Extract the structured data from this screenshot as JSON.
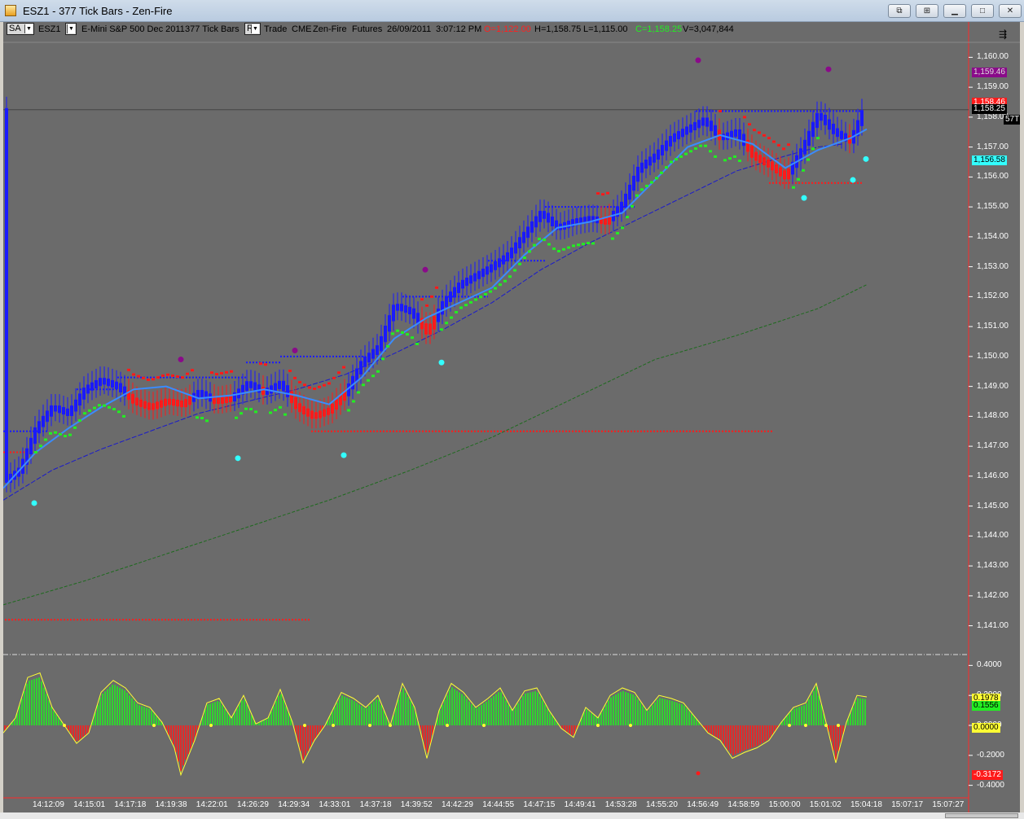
{
  "window": {
    "title": "ESZ1 - 377 Tick Bars - Zen-Fire"
  },
  "status": {
    "sa": "SA",
    "instrument": "ESZ1",
    "instr_label": "E-Mini S&P 500 Dec 2011",
    "bar_type": "377 Tick Bars",
    "r_btn": "R",
    "trade": "Trade",
    "exchange": "CME",
    "feed": "Zen-Fire",
    "kind": "Futures",
    "date": "26/09/2011",
    "time": "3:07:12 PM",
    "open": "O=1,122.00",
    "high": "H=1,158.75",
    "low": "L=1,115.00",
    "close": "C=1,158.25",
    "volume": "V=3,047,844"
  },
  "price_axis": [
    "1,160.00",
    "1,159.00",
    "1,158.00",
    "1,157.00",
    "1,156.00",
    "1,155.00",
    "1,154.00",
    "1,153.00",
    "1,152.00",
    "1,151.00",
    "1,150.00",
    "1,149.00",
    "1,148.00",
    "1,147.00",
    "1,146.00",
    "1,145.00",
    "1,144.00",
    "1,143.00",
    "1,142.00",
    "1,141.00"
  ],
  "price_tags": {
    "purple": "1,159.46",
    "red": "1,158.46",
    "last": "1,158.25",
    "tick": "57T",
    "cyan": "1,156.58"
  },
  "osc_axis": [
    "0.4000",
    "0.2000",
    "0.0000",
    "-0.2000",
    "-0.4000"
  ],
  "osc_tags": {
    "yellow": "0.1978",
    "green": "0.1556",
    "zero": "0.0000",
    "red": "-0.3172"
  },
  "time_axis": [
    "14:12:09",
    "14:15:01",
    "14:17:18",
    "14:19:38",
    "14:22:01",
    "14:26:29",
    "14:29:34",
    "14:33:01",
    "14:37:18",
    "14:39:52",
    "14:42:29",
    "14:44:55",
    "14:47:15",
    "14:49:41",
    "14:53:28",
    "14:55:20",
    "14:56:49",
    "14:58:59",
    "15:00:00",
    "15:01:02",
    "15:04:18",
    "15:07:17",
    "15:07:27"
  ],
  "colors": {
    "bg": "#6b6b6b",
    "up": "#1a1aff",
    "down": "#ff1a1a",
    "green": "#22ee22",
    "cyan": "#33ffff",
    "purple": "#8a0a8a",
    "yellow": "#ffff33"
  },
  "chart_data": {
    "type": "bar",
    "instrument": "ESZ1",
    "ylim": [
      1140.5,
      1160.5
    ],
    "close_path": [
      [
        0,
        1145.8
      ],
      [
        20,
        1146.2
      ],
      [
        40,
        1147.6
      ],
      [
        60,
        1148.3
      ],
      [
        80,
        1148.1
      ],
      [
        100,
        1148.9
      ],
      [
        120,
        1149.2
      ],
      [
        140,
        1149.0
      ],
      [
        160,
        1148.5
      ],
      [
        180,
        1148.3
      ],
      [
        200,
        1148.5
      ],
      [
        220,
        1148.4
      ],
      [
        240,
        1148.8
      ],
      [
        260,
        1148.5
      ],
      [
        280,
        1148.6
      ],
      [
        300,
        1149.1
      ],
      [
        320,
        1148.8
      ],
      [
        340,
        1149.1
      ],
      [
        360,
        1148.3
      ],
      [
        380,
        1148.0
      ],
      [
        400,
        1148.2
      ],
      [
        420,
        1148.8
      ],
      [
        440,
        1149.8
      ],
      [
        460,
        1150.3
      ],
      [
        480,
        1151.7
      ],
      [
        500,
        1151.5
      ],
      [
        520,
        1150.8
      ],
      [
        540,
        1151.8
      ],
      [
        560,
        1152.4
      ],
      [
        580,
        1152.7
      ],
      [
        600,
        1153.0
      ],
      [
        620,
        1153.4
      ],
      [
        640,
        1154.1
      ],
      [
        660,
        1154.8
      ],
      [
        680,
        1154.3
      ],
      [
        700,
        1154.5
      ],
      [
        720,
        1154.6
      ],
      [
        740,
        1154.5
      ],
      [
        760,
        1155.1
      ],
      [
        780,
        1156.3
      ],
      [
        800,
        1156.7
      ],
      [
        820,
        1157.3
      ],
      [
        840,
        1157.6
      ],
      [
        860,
        1157.9
      ],
      [
        880,
        1157.3
      ],
      [
        900,
        1157.5
      ],
      [
        920,
        1156.7
      ],
      [
        940,
        1156.4
      ],
      [
        960,
        1156.0
      ],
      [
        980,
        1156.9
      ],
      [
        1000,
        1158.1
      ],
      [
        1020,
        1157.5
      ],
      [
        1040,
        1157.2
      ],
      [
        1055,
        1158.2
      ]
    ],
    "ema_fast_path": [
      [
        0,
        1145.6
      ],
      [
        40,
        1146.8
      ],
      [
        80,
        1147.6
      ],
      [
        120,
        1148.3
      ],
      [
        160,
        1148.9
      ],
      [
        200,
        1149.0
      ],
      [
        240,
        1148.6
      ],
      [
        280,
        1148.7
      ],
      [
        320,
        1148.9
      ],
      [
        360,
        1148.7
      ],
      [
        400,
        1148.4
      ],
      [
        440,
        1149.3
      ],
      [
        480,
        1150.6
      ],
      [
        520,
        1151.3
      ],
      [
        560,
        1151.8
      ],
      [
        600,
        1152.3
      ],
      [
        640,
        1153.4
      ],
      [
        680,
        1154.3
      ],
      [
        720,
        1154.5
      ],
      [
        760,
        1154.8
      ],
      [
        800,
        1155.9
      ],
      [
        840,
        1157.0
      ],
      [
        880,
        1157.4
      ],
      [
        920,
        1157.1
      ],
      [
        960,
        1156.3
      ],
      [
        1000,
        1156.9
      ],
      [
        1040,
        1157.3
      ],
      [
        1060,
        1157.6
      ]
    ],
    "ema_slow_path": [
      [
        0,
        1145.2
      ],
      [
        60,
        1146.2
      ],
      [
        120,
        1146.9
      ],
      [
        180,
        1147.5
      ],
      [
        240,
        1148.1
      ],
      [
        300,
        1148.5
      ],
      [
        360,
        1148.9
      ],
      [
        420,
        1149.4
      ],
      [
        480,
        1150.1
      ],
      [
        540,
        1150.9
      ],
      [
        600,
        1151.8
      ],
      [
        660,
        1152.9
      ],
      [
        720,
        1153.8
      ],
      [
        780,
        1154.6
      ],
      [
        840,
        1155.4
      ],
      [
        900,
        1156.2
      ],
      [
        960,
        1156.7
      ],
      [
        1000,
        1157.0
      ],
      [
        1030,
        1157.1
      ]
    ],
    "ema_long_path": [
      [
        0,
        1141.7
      ],
      [
        100,
        1142.5
      ],
      [
        200,
        1143.4
      ],
      [
        300,
        1144.3
      ],
      [
        400,
        1145.2
      ],
      [
        500,
        1146.2
      ],
      [
        600,
        1147.3
      ],
      [
        700,
        1148.6
      ],
      [
        800,
        1149.9
      ],
      [
        900,
        1150.7
      ],
      [
        1000,
        1151.6
      ],
      [
        1060,
        1152.4
      ]
    ],
    "osc_path": [
      [
        0,
        -0.05
      ],
      [
        15,
        0.05
      ],
      [
        30,
        0.32
      ],
      [
        45,
        0.35
      ],
      [
        60,
        0.12
      ],
      [
        75,
        0.0
      ],
      [
        90,
        -0.12
      ],
      [
        105,
        -0.05
      ],
      [
        120,
        0.22
      ],
      [
        135,
        0.3
      ],
      [
        150,
        0.25
      ],
      [
        165,
        0.15
      ],
      [
        180,
        0.12
      ],
      [
        195,
        0.02
      ],
      [
        210,
        -0.15
      ],
      [
        218,
        -0.33
      ],
      [
        235,
        -0.1
      ],
      [
        250,
        0.15
      ],
      [
        265,
        0.18
      ],
      [
        280,
        0.05
      ],
      [
        295,
        0.2
      ],
      [
        310,
        0.01
      ],
      [
        325,
        0.05
      ],
      [
        340,
        0.24
      ],
      [
        355,
        0.02
      ],
      [
        368,
        -0.25
      ],
      [
        382,
        -0.1
      ],
      [
        395,
        0.0
      ],
      [
        415,
        0.22
      ],
      [
        430,
        0.18
      ],
      [
        445,
        0.12
      ],
      [
        460,
        0.2
      ],
      [
        475,
        0.0
      ],
      [
        490,
        0.28
      ],
      [
        505,
        0.12
      ],
      [
        520,
        -0.22
      ],
      [
        535,
        0.1
      ],
      [
        550,
        0.28
      ],
      [
        565,
        0.22
      ],
      [
        580,
        0.12
      ],
      [
        595,
        0.18
      ],
      [
        610,
        0.25
      ],
      [
        625,
        0.1
      ],
      [
        640,
        0.23
      ],
      [
        655,
        0.25
      ],
      [
        670,
        0.1
      ],
      [
        685,
        -0.02
      ],
      [
        700,
        -0.08
      ],
      [
        715,
        0.12
      ],
      [
        730,
        0.05
      ],
      [
        745,
        0.2
      ],
      [
        760,
        0.25
      ],
      [
        775,
        0.22
      ],
      [
        790,
        0.1
      ],
      [
        805,
        0.2
      ],
      [
        820,
        0.18
      ],
      [
        835,
        0.15
      ],
      [
        850,
        0.05
      ],
      [
        865,
        -0.05
      ],
      [
        880,
        -0.1
      ],
      [
        895,
        -0.22
      ],
      [
        910,
        -0.18
      ],
      [
        925,
        -0.15
      ],
      [
        940,
        -0.1
      ],
      [
        955,
        0.02
      ],
      [
        970,
        0.12
      ],
      [
        985,
        0.15
      ],
      [
        998,
        0.28
      ],
      [
        1010,
        0.02
      ],
      [
        1022,
        -0.25
      ],
      [
        1035,
        0.02
      ],
      [
        1048,
        0.2
      ],
      [
        1060,
        0.19
      ]
    ],
    "osc_ylim": [
      -0.44,
      0.44
    ]
  }
}
